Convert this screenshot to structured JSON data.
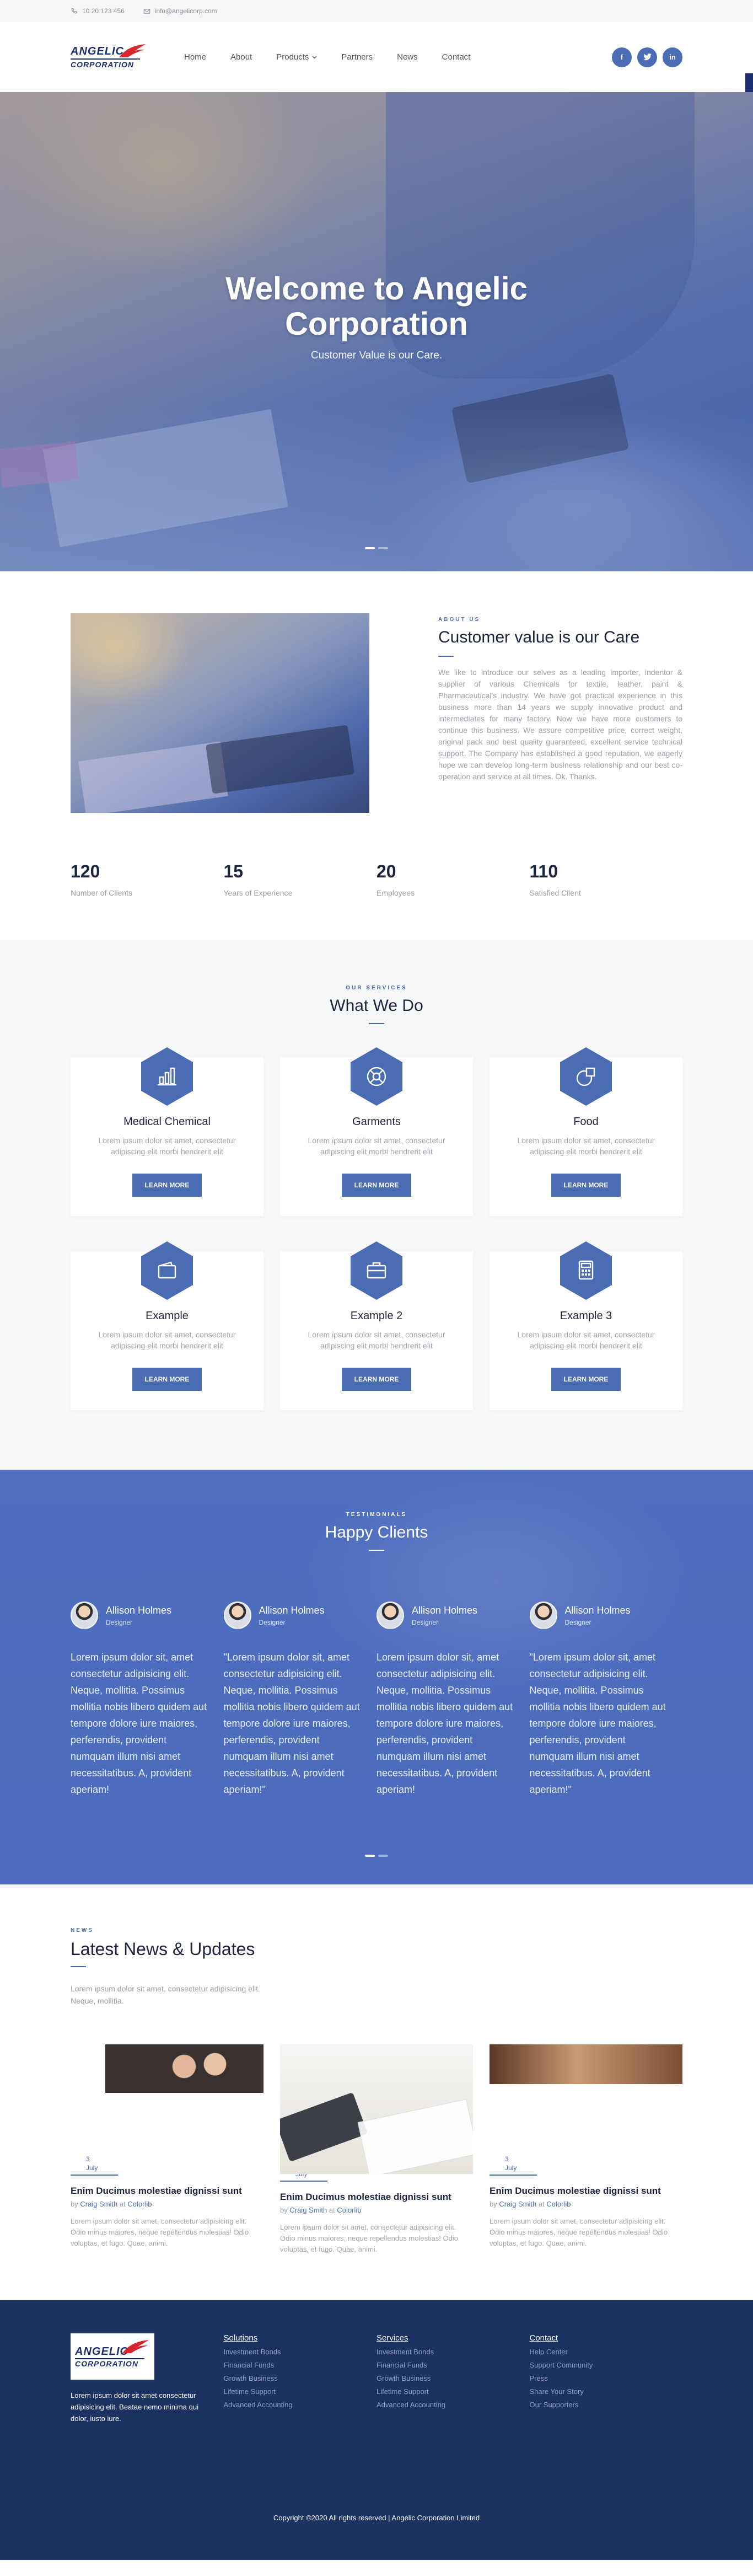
{
  "topbar": {
    "phone": "10 20 123 456",
    "email": "info@angelicorp.com"
  },
  "logo": {
    "line1": "ANGELIC",
    "line2": "CORPORATION"
  },
  "nav": [
    "Home",
    "About",
    "Products",
    "Partners",
    "News",
    "Contact"
  ],
  "social": [
    "f",
    "t",
    "in"
  ],
  "hero": {
    "title_line1": "Welcome to Angelic",
    "title_line2": "Corporation",
    "subtitle": "Customer Value is our Care."
  },
  "about": {
    "eyebrow": "ABOUT US",
    "title": "Customer value is our Care",
    "body": "We like to introduce our selves as a leading importer, indentor & supplier of various Chemicals for textile, leather, paint & Pharmaceutical's industry. We have got practical experience in this business more than 14 years we supply innovative product and intermediates for many factory. Now we have more customers to continue this business. We assure competitive price, correct weight, original pack and best quality guaranteed, excellent service technical support. The Company has established a good reputation, we eagerly hope we can develop long-term business relationship and our best co-operation and service at all times. Ok. Thanks."
  },
  "stats": [
    {
      "value": "120",
      "label": "Number of Clients"
    },
    {
      "value": "15",
      "label": "Years of Experience"
    },
    {
      "value": "20",
      "label": "Employees"
    },
    {
      "value": "110",
      "label": "Satisfied Client"
    }
  ],
  "services": {
    "eyebrow": "OUR SERVICES",
    "title": "What We Do",
    "items": [
      {
        "title": "Medical Chemical",
        "text": "Lorem ipsum dolor sit amet, consectetur adipiscing elit morbi hendrerit elit",
        "button": "LEARN MORE",
        "icon": "chart-icon"
      },
      {
        "title": "Garments",
        "text": "Lorem ipsum dolor sit amet, consectetur adipiscing elit morbi hendrerit elit",
        "button": "LEARN MORE",
        "icon": "lifebuoy-icon"
      },
      {
        "title": "Food",
        "text": "Lorem ipsum dolor sit amet, consectetur adipiscing elit morbi hendrerit elit",
        "button": "LEARN MORE",
        "icon": "circle-square-icon"
      },
      {
        "title": "Example",
        "text": "Lorem ipsum dolor sit amet, consectetur adipiscing elit morbi hendrerit elit",
        "button": "LEARN MORE",
        "icon": "wallet-icon"
      },
      {
        "title": "Example 2",
        "text": "Lorem ipsum dolor sit amet, consectetur adipiscing elit morbi hendrerit elit",
        "button": "LEARN MORE",
        "icon": "briefcase-icon"
      },
      {
        "title": "Example 3",
        "text": "Lorem ipsum dolor sit amet, consectetur adipiscing elit morbi hendrerit elit",
        "button": "LEARN MORE",
        "icon": "calculator-icon"
      }
    ]
  },
  "testimonials": {
    "eyebrow": "TESTIMONIALS",
    "title": "Happy Clients",
    "items": [
      {
        "name": "Allison Holmes",
        "role": "Designer",
        "quote": "Lorem ipsum dolor sit, amet consectetur adipisicing elit. Neque, mollitia. Possimus mollitia nobis libero quidem aut tempore dolore iure maiores, perferendis, provident numquam illum nisi amet necessitatibus. A, provident aperiam!"
      },
      {
        "name": "Allison Holmes",
        "role": "Designer",
        "quote": "\"Lorem ipsum dolor sit, amet consectetur adipisicing elit. Neque, mollitia. Possimus mollitia nobis libero quidem aut tempore dolore iure maiores, perferendis, provident numquam illum nisi amet necessitatibus. A, provident aperiam!\""
      },
      {
        "name": "Allison Holmes",
        "role": "Designer",
        "quote": "Lorem ipsum dolor sit, amet consectetur adipisicing elit. Neque, mollitia. Possimus mollitia nobis libero quidem aut tempore dolore iure maiores, perferendis, provident numquam illum nisi amet necessitatibus. A, provident aperiam!"
      },
      {
        "name": "Allison Holmes",
        "role": "Designer",
        "quote": "\"Lorem ipsum dolor sit, amet consectetur adipisicing elit. Neque, mollitia. Possimus mollitia nobis libero quidem aut tempore dolore iure maiores, perferendis, provident numquam illum nisi amet necessitatibus. A, provident aperiam!\""
      }
    ]
  },
  "news": {
    "eyebrow": "NEWS",
    "title": "Latest News & Updates",
    "intro": "Lorem ipsum dolor sit amet, consectetur adipisicing elit. Neque, mollitia.",
    "items": [
      {
        "day": "3",
        "month": "July",
        "title": "Enim Ducimus molestiae dignissi sunt",
        "by": "by",
        "author": "Craig Smith",
        "at": "at",
        "place": "Colorlib",
        "text": "Lorem ipsum dolor sit amet, consectetur adipisicing elit. Odio minus maiores, neque repellendus molestias! Odio voluptas, et fugo. Quae, animi."
      },
      {
        "day": "3",
        "month": "July",
        "title": "Enim Ducimus molestiae dignissi sunt",
        "by": "by",
        "author": "Craig Smith",
        "at": "at",
        "place": "Colorlib",
        "text": "Lorem ipsum dolor sit amet, consectetur adipisicing elit. Odio minus maiores, neque repellendus molestias! Odio voluptas, et fugo. Quae, animi."
      },
      {
        "day": "3",
        "month": "July",
        "title": "Enim Ducimus molestiae dignissi sunt",
        "by": "by",
        "author": "Craig Smith",
        "at": "at",
        "place": "Colorlib",
        "text": "Lorem ipsum dolor sit amet, consectetur adipisicing elit. Odio minus maiores, neque repellendus molestias! Odio voluptas, et fugo. Quae, animi."
      }
    ]
  },
  "footer": {
    "desc": "Lorem ipsum dolor sit amet consectetur adipisicing elit. Beatae nemo minima qui dolor, iusto iure.",
    "cols": [
      {
        "title": "Solutions",
        "links": [
          "Investment Bonds",
          "Financial Funds",
          "Growth Business",
          "Lifetime Support",
          "Advanced Accounting"
        ]
      },
      {
        "title": "Services",
        "links": [
          "Investment Bonds",
          "Financial Funds",
          "Growth Business",
          "Lifetime Support",
          "Advanced Accounting"
        ]
      },
      {
        "title": "Contact",
        "links": [
          "Help Center",
          "Support Community",
          "Press",
          "Share Your Story",
          "Our Supporters"
        ]
      }
    ],
    "copyright": "Copyright ©2020 All rights reserved | Angelic Corporation Limited"
  },
  "colors": {
    "accent": "#4a6cb3",
    "navy": "#1b3263"
  }
}
